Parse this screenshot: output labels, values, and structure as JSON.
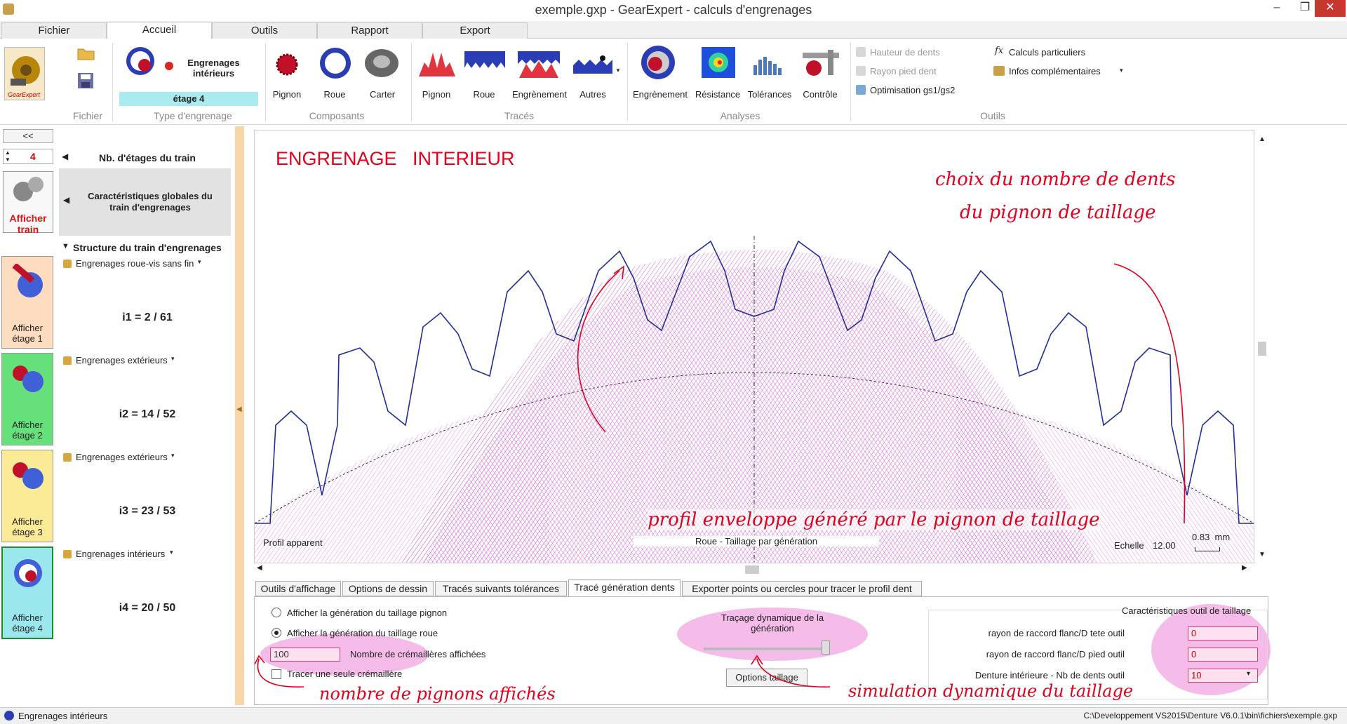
{
  "window": {
    "title": "exemple.gxp - GearExpert - calculs d'engrenages",
    "min": "–",
    "max": "❐",
    "close": "✕"
  },
  "tabs": [
    "Fichier",
    "Accueil",
    "Outils",
    "Rapport",
    "Export"
  ],
  "ribbon": {
    "type_label": "Engrenages\nintérieurs",
    "stage_label": "étage 4",
    "comp_items": [
      "Pignon",
      "Roue",
      "Carter"
    ],
    "trace_items": [
      "Pignon",
      "Roue",
      "Engrènement",
      "Autres"
    ],
    "analysis_items": [
      "Engrènement",
      "Résistance",
      "Tolérances",
      "Contrôle"
    ],
    "tools_items": [
      "Hauteur de dents",
      "Rayon pied dent",
      "Optimisation gs1/gs2"
    ],
    "tools_items2": [
      "Calculs particuliers",
      "Infos complémentaires"
    ],
    "groups": [
      "Fichier",
      "Type d'engrenage",
      "Composants",
      "Tracés",
      "Analyses",
      "Outils"
    ],
    "logo": "GearExpert"
  },
  "left": {
    "collapse": "<<",
    "nb_stages_value": "4",
    "nb_stages_label": "Nb. d'étages du train",
    "show_train": "Afficher\ntrain",
    "global_chars": "Caractéristiques globales du\ntrain d'engrenages",
    "structure": "Structure du train d'engrenages",
    "stages": [
      {
        "type": "Engrenages roue-vis sans fin",
        "ratio": "i1 = 2 / 61",
        "btn": "Afficher\nétage 1",
        "color": "#fddcc0"
      },
      {
        "type": "Engrenages extérieurs",
        "ratio": "i2 = 14 / 52",
        "btn": "Afficher\nétage 2",
        "color": "#66e07a"
      },
      {
        "type": "Engrenages extérieurs",
        "ratio": "i3 = 23 / 53",
        "btn": "Afficher\nétage 3",
        "color": "#fbea96"
      },
      {
        "type": "Engrenages intérieurs",
        "ratio": "i4 = 20 / 50",
        "btn": "Afficher\nétage 4",
        "color": "#9ae8ee"
      }
    ]
  },
  "drawing": {
    "title": "ENGRENAGE   INTERIEUR",
    "profile": "Profil apparent",
    "caption": "Roue - Taillage par génération",
    "scale_label": "Echelle",
    "scale_value": "12.00",
    "unit": "0.83  mm",
    "ann_top1": "choix du nombre de dents",
    "ann_top2": "du pignon de taillage",
    "ann_mid": "profil enveloppe généré par le pignon de taillage"
  },
  "bottom_tabs": [
    "Outils d'affichage",
    "Options de dessin",
    "Tracés suivants tolérances",
    "Tracé génération dents",
    "Exporter points ou cercles pour tracer le profil dent"
  ],
  "bottom": {
    "radio1": "Afficher la génération du taillage pignon",
    "radio2": "Afficher la génération du taillage roue",
    "count_value": "100",
    "count_label": "Nombre de crémaillères affichées",
    "single": "Tracer une seule crémaillère",
    "dyn_label": "Traçage dynamique de la\ngénération",
    "options_btn": "Options taillage",
    "tool_title": "Caractéristiques outil de taillage",
    "f1_label": "rayon de raccord flanc/D tete outil",
    "f1_val": "0",
    "f2_label": "rayon de raccord flanc/D pied outil",
    "f2_val": "0",
    "f3_label": "Denture intérieure - Nb de dents outil",
    "f3_val": "10",
    "ann_left": "nombre de pignons affichés",
    "ann_right": "simulation dynamique du taillage"
  },
  "status": {
    "left": "Engrenages intérieurs",
    "right": "C:\\Developpement VS2015\\Denture V6.0.1\\bin\\fichiers\\exemple.gxp"
  }
}
